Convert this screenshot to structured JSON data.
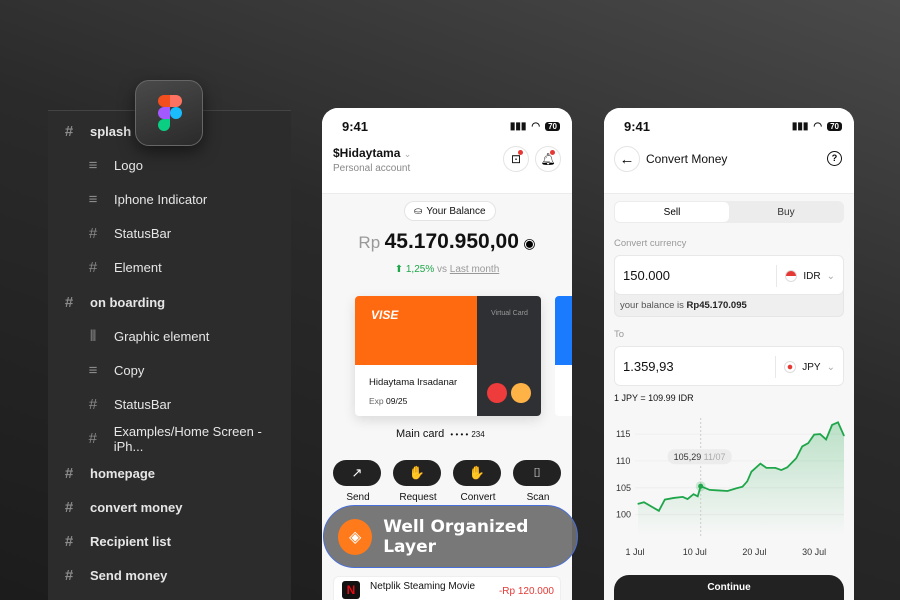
{
  "layers": [
    {
      "label": "splash",
      "level": "top",
      "icon": "frame-icon"
    },
    {
      "label": "Logo",
      "level": "sub",
      "icon": "text-left-icon"
    },
    {
      "label": "Iphone Indicator",
      "level": "sub",
      "icon": "text-center-icon"
    },
    {
      "label": "StatusBar",
      "level": "sub",
      "icon": "frame-icon"
    },
    {
      "label": "Element",
      "level": "sub",
      "icon": "frame-icon"
    },
    {
      "label": "on boarding",
      "level": "top",
      "icon": "frame-icon"
    },
    {
      "label": "Graphic element",
      "level": "sub",
      "icon": "columns-icon"
    },
    {
      "label": "Copy",
      "level": "sub",
      "icon": "text-center-icon"
    },
    {
      "label": "StatusBar",
      "level": "sub",
      "icon": "frame-icon"
    },
    {
      "label": "Examples/Home Screen - iPh...",
      "level": "sub",
      "icon": "frame-icon"
    },
    {
      "label": "homepage",
      "level": "top",
      "icon": "frame-icon"
    },
    {
      "label": "convert money",
      "level": "top",
      "icon": "frame-icon"
    },
    {
      "label": "Recipient list",
      "level": "top",
      "icon": "frame-icon"
    },
    {
      "label": "Send money",
      "level": "top",
      "icon": "frame-icon"
    }
  ],
  "badge": {
    "label": "Well Organized Layer",
    "accent": "#ff7a1a"
  },
  "home": {
    "time": "9:41",
    "battery": "70",
    "account": "$Hidaytama",
    "account_type": "Personal account",
    "balance_label": "Your Balance",
    "currency": "Rp",
    "balance": "45.170.950,00",
    "change": "1,25%",
    "vs": "vs",
    "period": "Last month",
    "card": {
      "brand": "VISE",
      "type": "Virtual Card",
      "holder": "Hidaytama Irsadanar",
      "exp_label": "Exp",
      "exp": "09/25",
      "name": "Main card",
      "mask": "• • • •",
      "last": "234"
    },
    "actions": [
      {
        "label": "Send",
        "icon": "arrow-up-right-icon",
        "glyph": "↗"
      },
      {
        "label": "Request",
        "icon": "hand-coins-icon",
        "glyph": "✋"
      },
      {
        "label": "Convert",
        "icon": "hand-icon",
        "glyph": "✋"
      },
      {
        "label": "Scan",
        "icon": "scan-icon",
        "glyph": "⌷"
      }
    ],
    "transaction": {
      "title": "Netplik Steaming Movie",
      "amount": "-Rp 120.000"
    }
  },
  "convert": {
    "time": "9:41",
    "battery": "70",
    "title": "Convert Money",
    "tabs": [
      "Sell",
      "Buy"
    ],
    "active_tab": "Sell",
    "from_label": "Convert currency",
    "from_value": "150.000",
    "from_currency": "IDR",
    "balance_prefix": "your balance is",
    "balance": "Rp45.170.095",
    "to_label": "To",
    "to_value": "1.359,93",
    "to_currency": "JPY",
    "rate": "1 JPY = 109.99 IDR",
    "continue": "Continue"
  },
  "chart_data": {
    "type": "area",
    "x_ticks": [
      "1 Jul",
      "10 Jul",
      "20 Jul",
      "30 Jul"
    ],
    "y_ticks": [
      100,
      105,
      110,
      115
    ],
    "ylim": [
      97.5,
      118
    ],
    "xlim": [
      0,
      35
    ],
    "x": [
      0.5,
      1.5,
      4,
      5,
      6.5,
      8,
      8.8,
      9.8,
      10.5,
      11,
      12.5,
      14,
      15.5,
      17,
      18,
      18.8,
      19.5,
      21,
      22,
      23.5,
      24.5,
      25.5,
      27,
      28,
      29,
      30,
      31,
      32,
      33,
      34,
      35
    ],
    "y": [
      102,
      102.3,
      100.7,
      102.8,
      103.1,
      103.3,
      102.9,
      103.8,
      103.4,
      105.29,
      104.6,
      104.5,
      104.4,
      104.9,
      105.2,
      106.2,
      108,
      109.5,
      108.7,
      108.7,
      108.3,
      108.8,
      110.5,
      112.7,
      113.3,
      114.9,
      115,
      114,
      116.7,
      117.2,
      114.7
    ],
    "highlight": {
      "value": "105,29",
      "date": "11/07",
      "x": 11,
      "y": 105.29
    },
    "color": "#1fa64a"
  }
}
